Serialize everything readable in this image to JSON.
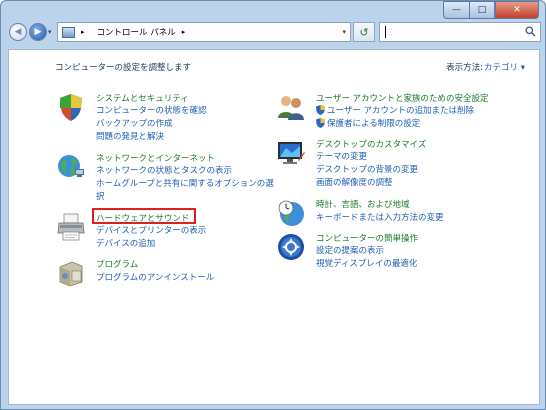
{
  "window": {
    "caption": {
      "minimize": "—",
      "maximize": "□",
      "close": "✕"
    }
  },
  "navbar": {
    "back": "◀",
    "forward": "▶",
    "dropdown": "▾",
    "breadcrumb": [
      "コントロール パネル"
    ],
    "crumb_sep": "▸",
    "address_dropdown": "▾",
    "refresh": "↺",
    "search_placeholder": ""
  },
  "header": {
    "heading": "コンピューターの設定を調整します",
    "view_by_label": "表示方法:",
    "view_by_value": "カテゴリ ▾"
  },
  "left": [
    {
      "title": "システムとセキュリティ",
      "icon": "shield-check-icon",
      "links": [
        "コンピューターの状態を確認",
        "バックアップの作成",
        "問題の発見と解決"
      ]
    },
    {
      "title": "ネットワークとインターネット",
      "icon": "globe-network-icon",
      "links": [
        "ネットワークの状態とタスクの表示",
        "ホームグループと共有に関するオプションの選",
        "択"
      ]
    },
    {
      "title": "ハードウェアとサウンド",
      "icon": "printer-icon",
      "links": [
        "デバイスとプリンターの表示",
        "デバイスの追加"
      ]
    },
    {
      "title": "プログラム",
      "icon": "program-box-icon",
      "links": [
        "プログラムのアンインストール"
      ]
    }
  ],
  "right": [
    {
      "title": "ユーザー アカウントと家族のための安全設定",
      "icon": "users-icon",
      "links": [
        "ユーザー アカウントの追加または削除",
        "保護者による制限の設定"
      ]
    },
    {
      "title": "デスクトップのカスタマイズ",
      "icon": "monitor-icon",
      "links": [
        "テーマの変更",
        "デスクトップの背景の変更",
        "画面の解像度の調整"
      ]
    },
    {
      "title": "時計、言語、および地域",
      "icon": "clock-globe-icon",
      "links": [
        "キーボードまたは入力方法の変更"
      ]
    },
    {
      "title": "コンピューターの簡単操作",
      "icon": "ease-of-access-icon",
      "links": [
        "設定の提案の表示",
        "視覚ディスプレイの最適化"
      ]
    }
  ],
  "colors": {
    "link": "#1e5fb4",
    "category_title": "#1a7a2a",
    "highlight": "#e0201c"
  }
}
